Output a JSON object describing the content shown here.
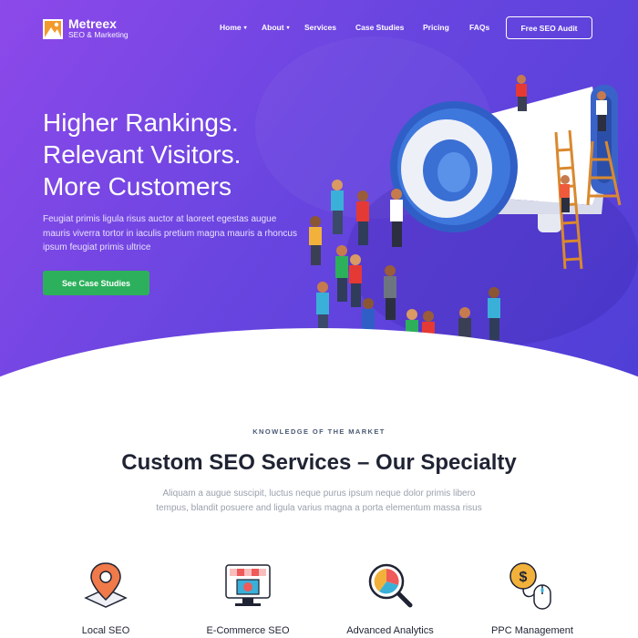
{
  "brand": {
    "name": "Metreex",
    "tagline": "SEO & Marketing"
  },
  "nav": {
    "items": [
      {
        "label": "Home",
        "has_caret": true
      },
      {
        "label": "About",
        "has_caret": true
      },
      {
        "label": "Services",
        "has_caret": false
      },
      {
        "label": "Case Studies",
        "has_caret": false
      },
      {
        "label": "Pricing",
        "has_caret": false
      },
      {
        "label": "FAQs",
        "has_caret": false
      }
    ],
    "cta_label": "Free SEO Audit"
  },
  "hero": {
    "title_lines": [
      "Higher Rankings.",
      "Relevant Visitors.",
      "More Customers"
    ],
    "description": "Feugiat primis ligula risus auctor at laoreet egestas augue mauris viverra tortor in iaculis pretium magna mauris a rhoncus ipsum feugiat primis ultrice",
    "button_label": "See Case Studies",
    "illustration_icon": "megaphone-crowd-illustration"
  },
  "services_section": {
    "eyebrow": "KNOWLEDGE OF THE MARKET",
    "title": "Custom SEO Services – Our Specialty",
    "description": "Aliquam a augue suscipit, luctus neque purus ipsum neque dolor primis libero tempus, blandit posuere and ligula varius magna a porta elementum massa risus",
    "items": [
      {
        "label": "Local SEO",
        "icon": "map-pin-icon"
      },
      {
        "label": "E-Commerce SEO",
        "icon": "online-store-icon"
      },
      {
        "label": "Advanced Analytics",
        "icon": "magnifier-chart-icon"
      },
      {
        "label": "PPC Management",
        "icon": "coin-mouse-icon"
      }
    ]
  },
  "colors": {
    "hero_gradient_start": "#8d49ea",
    "hero_gradient_end": "#4f3fd6",
    "cta_green": "#2db05c",
    "heading_dark": "#1f2333",
    "muted_text": "#9aa0ac"
  }
}
